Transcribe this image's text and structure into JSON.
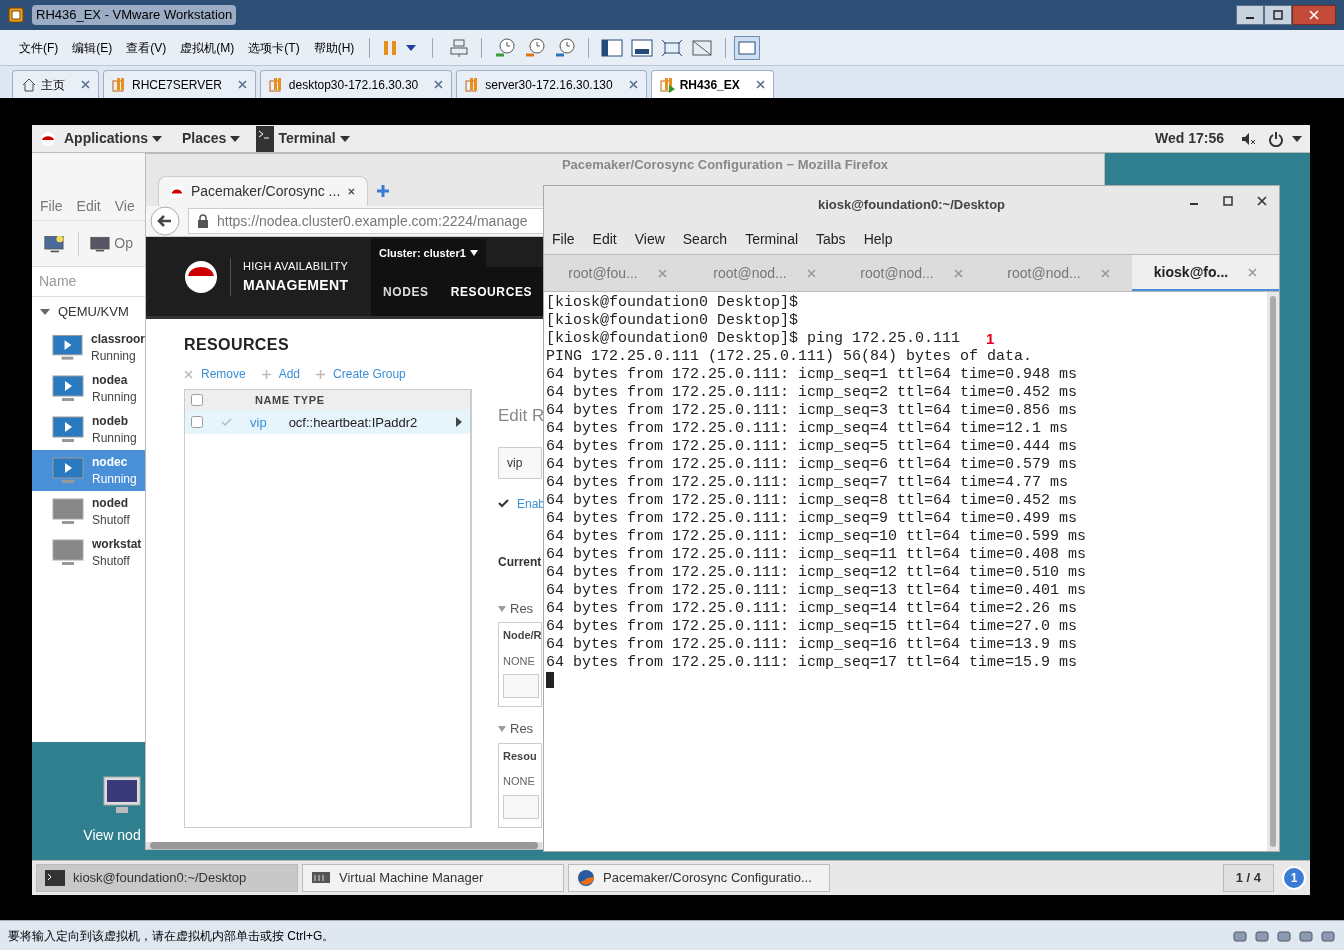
{
  "vmware": {
    "title": "RH436_EX - VMware Workstation",
    "menu": [
      "文件(F)",
      "编辑(E)",
      "查看(V)",
      "虚拟机(M)",
      "选项卡(T)",
      "帮助(H)"
    ],
    "tabs": [
      {
        "label": "主页",
        "kind": "home",
        "selected": false
      },
      {
        "label": "RHCE7SERVER",
        "kind": "vm",
        "selected": false
      },
      {
        "label": "desktop30-172.16.30.30",
        "kind": "vm",
        "selected": false
      },
      {
        "label": "server30-172.16.30.130",
        "kind": "vm",
        "selected": false
      },
      {
        "label": "RH436_EX",
        "kind": "vm",
        "selected": true
      }
    ],
    "status_text": "要将输入定向到该虚拟机，请在虚拟机内部单击或按 Ctrl+G。"
  },
  "guest": {
    "top_bar": {
      "applications": "Applications",
      "places": "Places",
      "terminal": "Terminal",
      "clock": "Wed 17:56"
    },
    "vm_manager": {
      "menu": [
        "File",
        "Edit",
        "Vie"
      ],
      "open_label": "Op",
      "column": "Name",
      "group": "QEMU/KVM",
      "vms": [
        {
          "name": "classroor",
          "status": "Running",
          "on": true,
          "selected": false
        },
        {
          "name": "nodea",
          "status": "Running",
          "on": true,
          "selected": false
        },
        {
          "name": "nodeb",
          "status": "Running",
          "on": true,
          "selected": false
        },
        {
          "name": "nodec",
          "status": "Running",
          "on": true,
          "selected": true
        },
        {
          "name": "noded",
          "status": "Shutoff",
          "on": false,
          "selected": false
        },
        {
          "name": "workstat",
          "status": "Shutoff",
          "on": false,
          "selected": false
        }
      ]
    },
    "desktop_icon": {
      "label": "View nod"
    },
    "firefox": {
      "title": "Pacemaker/Corosync Configuration − Mozilla Firefox",
      "tab": "Pacemaker/Corosync ...",
      "url": "https://nodea.cluster0.example.com:2224/manage",
      "brand_top": "HIGH AVAILABILITY",
      "brand_bottom": "MANAGEMENT",
      "cluster": "Cluster: cluster1",
      "nav": [
        {
          "label": "NODES",
          "selected": false
        },
        {
          "label": "RESOURCES",
          "selected": true
        }
      ],
      "heading": "RESOURCES",
      "actions": [
        {
          "label": "Remove",
          "kind": "remove"
        },
        {
          "label": "Add",
          "kind": "add"
        },
        {
          "label": "Create Group",
          "kind": "add"
        }
      ],
      "columns": [
        "NAME",
        "TYPE"
      ],
      "rows": [
        {
          "name": "vip",
          "type": "ocf::heartbeat:IPaddr2",
          "checked": false,
          "selected": true
        }
      ],
      "edit": {
        "title": "Edit R",
        "name_value": "vip",
        "enabled": "Enab",
        "current": "Current",
        "sections": [
          {
            "title": "Res",
            "column": "Node/R",
            "value": "NONE"
          },
          {
            "title": "Res",
            "column": "Resou",
            "value": "NONE"
          }
        ]
      }
    },
    "terminal": {
      "title": "kiosk@foundation0:~/Desktop",
      "menu": [
        "File",
        "Edit",
        "View",
        "Search",
        "Terminal",
        "Tabs",
        "Help"
      ],
      "tabs": [
        {
          "label": "root@fou...",
          "selected": false
        },
        {
          "label": "root@nod...",
          "selected": false
        },
        {
          "label": "root@nod...",
          "selected": false
        },
        {
          "label": "root@nod...",
          "selected": false
        },
        {
          "label": "kiosk@fo...",
          "selected": true
        }
      ],
      "annotation": "1",
      "lines": [
        "[kiosk@foundation0 Desktop]$",
        "[kiosk@foundation0 Desktop]$",
        "[kiosk@foundation0 Desktop]$ ping 172.25.0.111",
        "PING 172.25.0.111 (172.25.0.111) 56(84) bytes of data.",
        "64 bytes from 172.25.0.111: icmp_seq=1 ttl=64 time=0.948 ms",
        "64 bytes from 172.25.0.111: icmp_seq=2 ttl=64 time=0.452 ms",
        "64 bytes from 172.25.0.111: icmp_seq=3 ttl=64 time=0.856 ms",
        "64 bytes from 172.25.0.111: icmp_seq=4 ttl=64 time=12.1 ms",
        "64 bytes from 172.25.0.111: icmp_seq=5 ttl=64 time=0.444 ms",
        "64 bytes from 172.25.0.111: icmp_seq=6 ttl=64 time=0.579 ms",
        "64 bytes from 172.25.0.111: icmp_seq=7 ttl=64 time=4.77 ms",
        "64 bytes from 172.25.0.111: icmp_seq=8 ttl=64 time=0.452 ms",
        "64 bytes from 172.25.0.111: icmp_seq=9 ttl=64 time=0.499 ms",
        "64 bytes from 172.25.0.111: icmp_seq=10 ttl=64 time=0.599 ms",
        "64 bytes from 172.25.0.111: icmp_seq=11 ttl=64 time=0.408 ms",
        "64 bytes from 172.25.0.111: icmp_seq=12 ttl=64 time=0.510 ms",
        "64 bytes from 172.25.0.111: icmp_seq=13 ttl=64 time=0.401 ms",
        "64 bytes from 172.25.0.111: icmp_seq=14 ttl=64 time=2.26 ms",
        "64 bytes from 172.25.0.111: icmp_seq=15 ttl=64 time=27.0 ms",
        "64 bytes from 172.25.0.111: icmp_seq=16 ttl=64 time=13.9 ms",
        "64 bytes from 172.25.0.111: icmp_seq=17 ttl=64 time=15.9 ms"
      ]
    },
    "taskbar": {
      "items": [
        {
          "label": "kiosk@foundation0:~/Desktop",
          "kind": "terminal",
          "selected": true
        },
        {
          "label": "Virtual Machine Manager",
          "kind": "vmm",
          "selected": false
        },
        {
          "label": "Pacemaker/Corosync Configuratio...",
          "kind": "firefox",
          "selected": false
        }
      ],
      "workspace": "1 / 4",
      "notifications": "1"
    }
  }
}
